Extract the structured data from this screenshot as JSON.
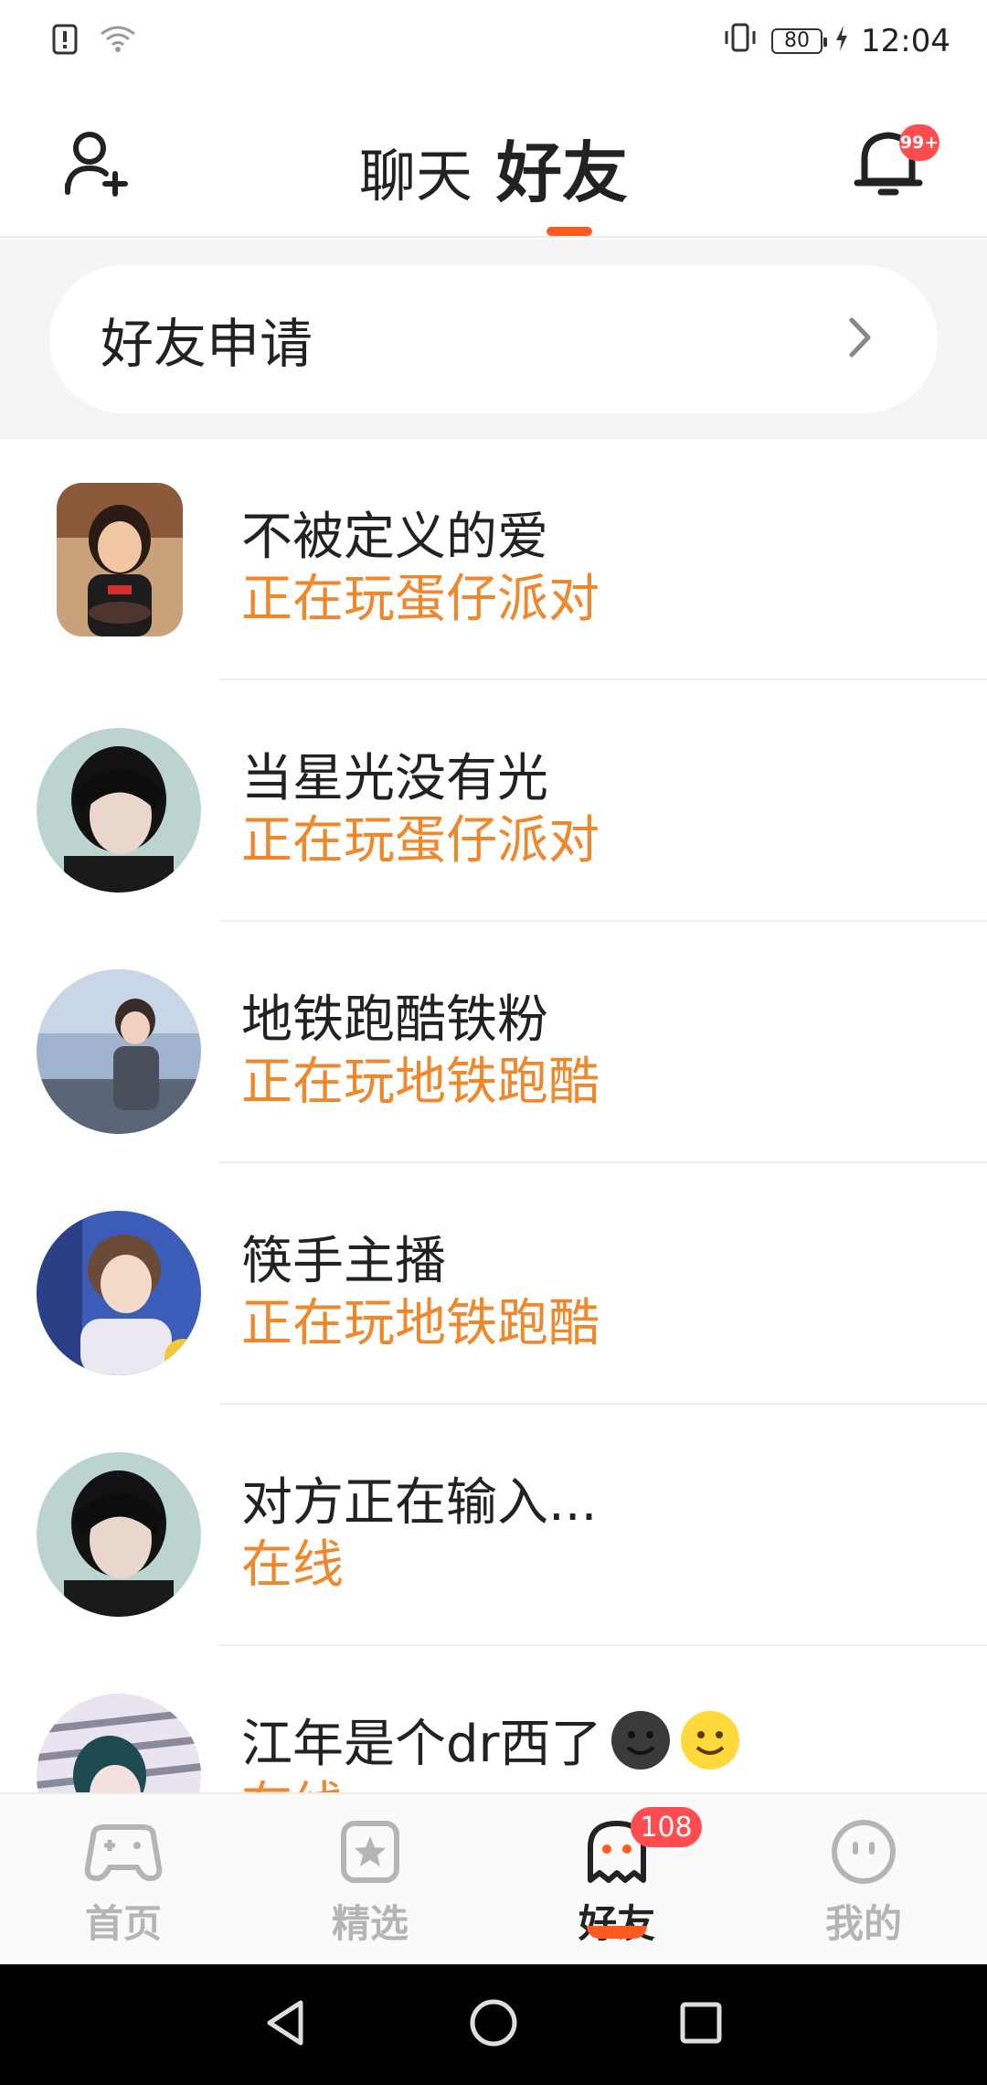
{
  "status_bar": {
    "time": "12:04",
    "battery": "80"
  },
  "header": {
    "tabs": [
      {
        "label": "聊天"
      },
      {
        "label": "好友"
      }
    ],
    "active_tab": "好友",
    "notification_badge": "99+"
  },
  "friend_request": {
    "label": "好友申请"
  },
  "friends": [
    {
      "name": "不被定义的爱",
      "status": "正在玩蛋仔派对"
    },
    {
      "name": "当星光没有光",
      "status": "正在玩蛋仔派对"
    },
    {
      "name": "地铁跑酷铁粉",
      "status": "正在玩地铁跑酷"
    },
    {
      "name": "筷手主播",
      "status": "正在玩地铁跑酷"
    },
    {
      "name": "对方正在输入...",
      "status": "在线"
    },
    {
      "name": "江年是个dr西了",
      "status": "在线"
    }
  ],
  "bottom_nav": {
    "items": [
      {
        "label": "首页"
      },
      {
        "label": "精选"
      },
      {
        "label": "好友"
      },
      {
        "label": "我的"
      }
    ],
    "active": "好友",
    "friends_badge": "108"
  },
  "colors": {
    "accent": "#ff5a1f",
    "status_text": "#f0872a",
    "badge": "#ff4d4f"
  }
}
